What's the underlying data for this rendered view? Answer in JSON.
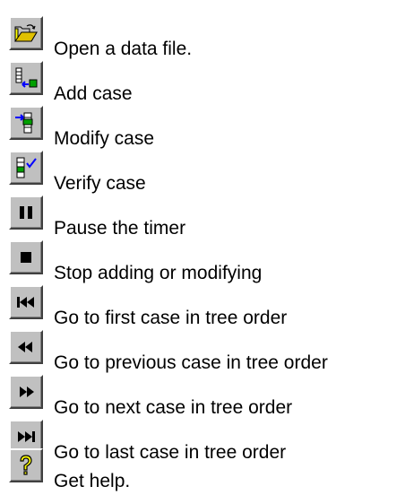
{
  "toolbar_legend": {
    "items": [
      {
        "icon": "open-folder-icon",
        "label": "Open a data file."
      },
      {
        "icon": "add-case-icon",
        "label": "Add case"
      },
      {
        "icon": "modify-case-icon",
        "label": "Modify case"
      },
      {
        "icon": "verify-case-icon",
        "label": "Verify case"
      },
      {
        "icon": "pause-icon",
        "label": "Pause the timer"
      },
      {
        "icon": "stop-icon",
        "label": "Stop adding or modifying"
      },
      {
        "icon": "first-case-icon",
        "label": "Go to first case in tree order"
      },
      {
        "icon": "previous-case-icon",
        "label": "Go to previous case in tree order"
      },
      {
        "icon": "next-case-icon",
        "label": "Go to next case in tree order"
      },
      {
        "icon": "last-case-icon",
        "label": "Go to last case in tree order"
      },
      {
        "icon": "help-icon",
        "label": "Get help."
      }
    ]
  }
}
